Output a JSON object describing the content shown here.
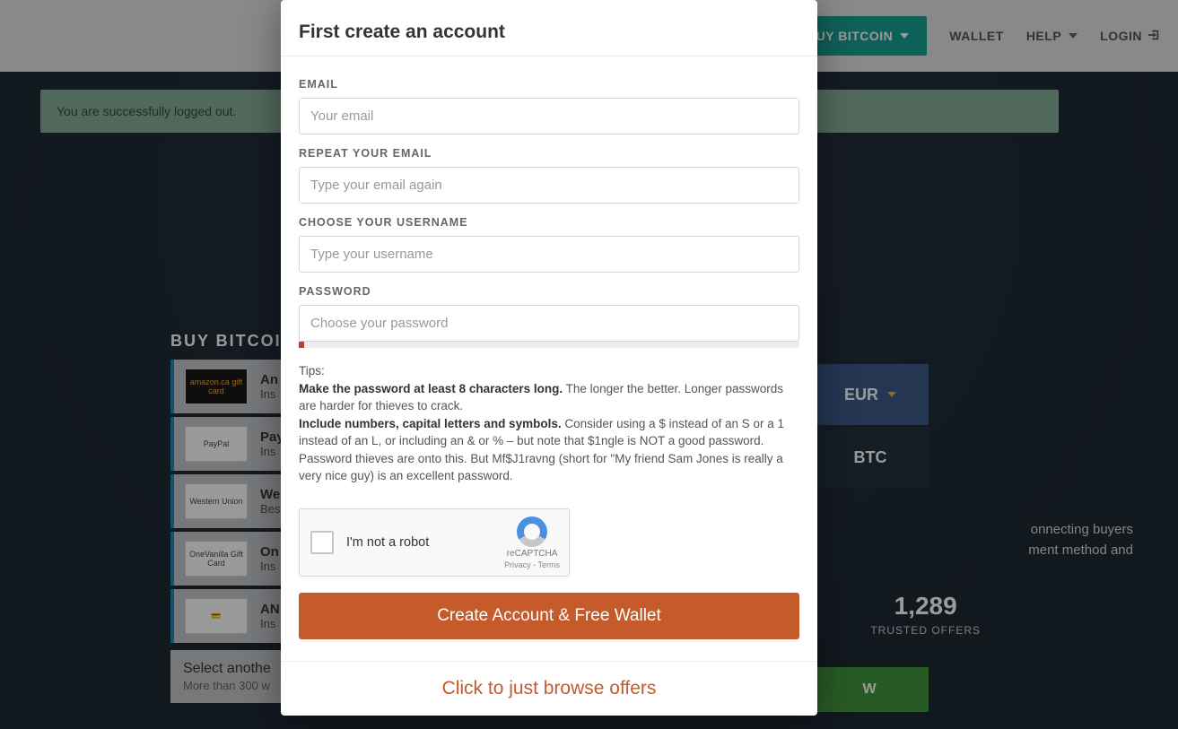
{
  "nav": {
    "buy_bitcoin": "BUY BITCOIN",
    "wallet": "WALLET",
    "help": "HELP",
    "login": "LOGIN"
  },
  "alert": {
    "logged_out": "You are successfully logged out."
  },
  "page": {
    "buy_heading": "BUY BITCOIN",
    "payment_methods": [
      {
        "logo_text": "amazon.ca gift card",
        "logo_class": "amazon",
        "title_prefix": "An",
        "sub_prefix": "Ins"
      },
      {
        "logo_text": "PayPal",
        "logo_class": "",
        "title_prefix": "Pay",
        "sub_prefix": "Ins"
      },
      {
        "logo_text": "Western Union",
        "logo_class": "",
        "title_prefix": "We",
        "sub_prefix": "Bes"
      },
      {
        "logo_text": "OneVanilla Gift Card",
        "logo_class": "",
        "title_prefix": "On",
        "sub_prefix": "Ins"
      },
      {
        "logo_text": "💳",
        "logo_class": "",
        "title_prefix": "AN",
        "sub_prefix": "Ins"
      }
    ],
    "select_another_title": "Select anothe",
    "select_another_sub": "More than 300 w",
    "currency_fiat": "EUR",
    "currency_crypto": "BTC",
    "side_text_1": "onnecting buyers",
    "side_text_2": "ment method and",
    "stat_value": "1,289",
    "stat_label": "TRUSTED OFFERS",
    "buy_now": "W"
  },
  "modal": {
    "title": "First create an account",
    "email_label": "EMAIL",
    "email_placeholder": "Your email",
    "repeat_email_label": "REPEAT YOUR EMAIL",
    "repeat_email_placeholder": "Type your email again",
    "username_label": "CHOOSE YOUR USERNAME",
    "username_placeholder": "Type your username",
    "password_label": "PASSWORD",
    "password_placeholder": "Choose your password",
    "tips_intro": "Tips:",
    "tip1_bold": "Make the password at least 8 characters long.",
    "tip1_rest": " The longer the better. Longer passwords are harder for thieves to crack.",
    "tip2_bold": "Include numbers, capital letters and symbols.",
    "tip2_rest": " Consider using a $ instead of an S or a 1 instead of an L, or including an & or % – but note that $1ngle is NOT a good password. Password thieves are onto this. But Mf$J1ravng (short for \"My friend Sam Jones is really a very nice guy) is an excellent password.",
    "recaptcha_label": "I'm not a robot",
    "recaptcha_caption": "reCAPTCHA",
    "recaptcha_privacy": "Privacy - Terms",
    "create_button": "Create Account & Free Wallet",
    "browse_link": "Click to just browse offers"
  }
}
